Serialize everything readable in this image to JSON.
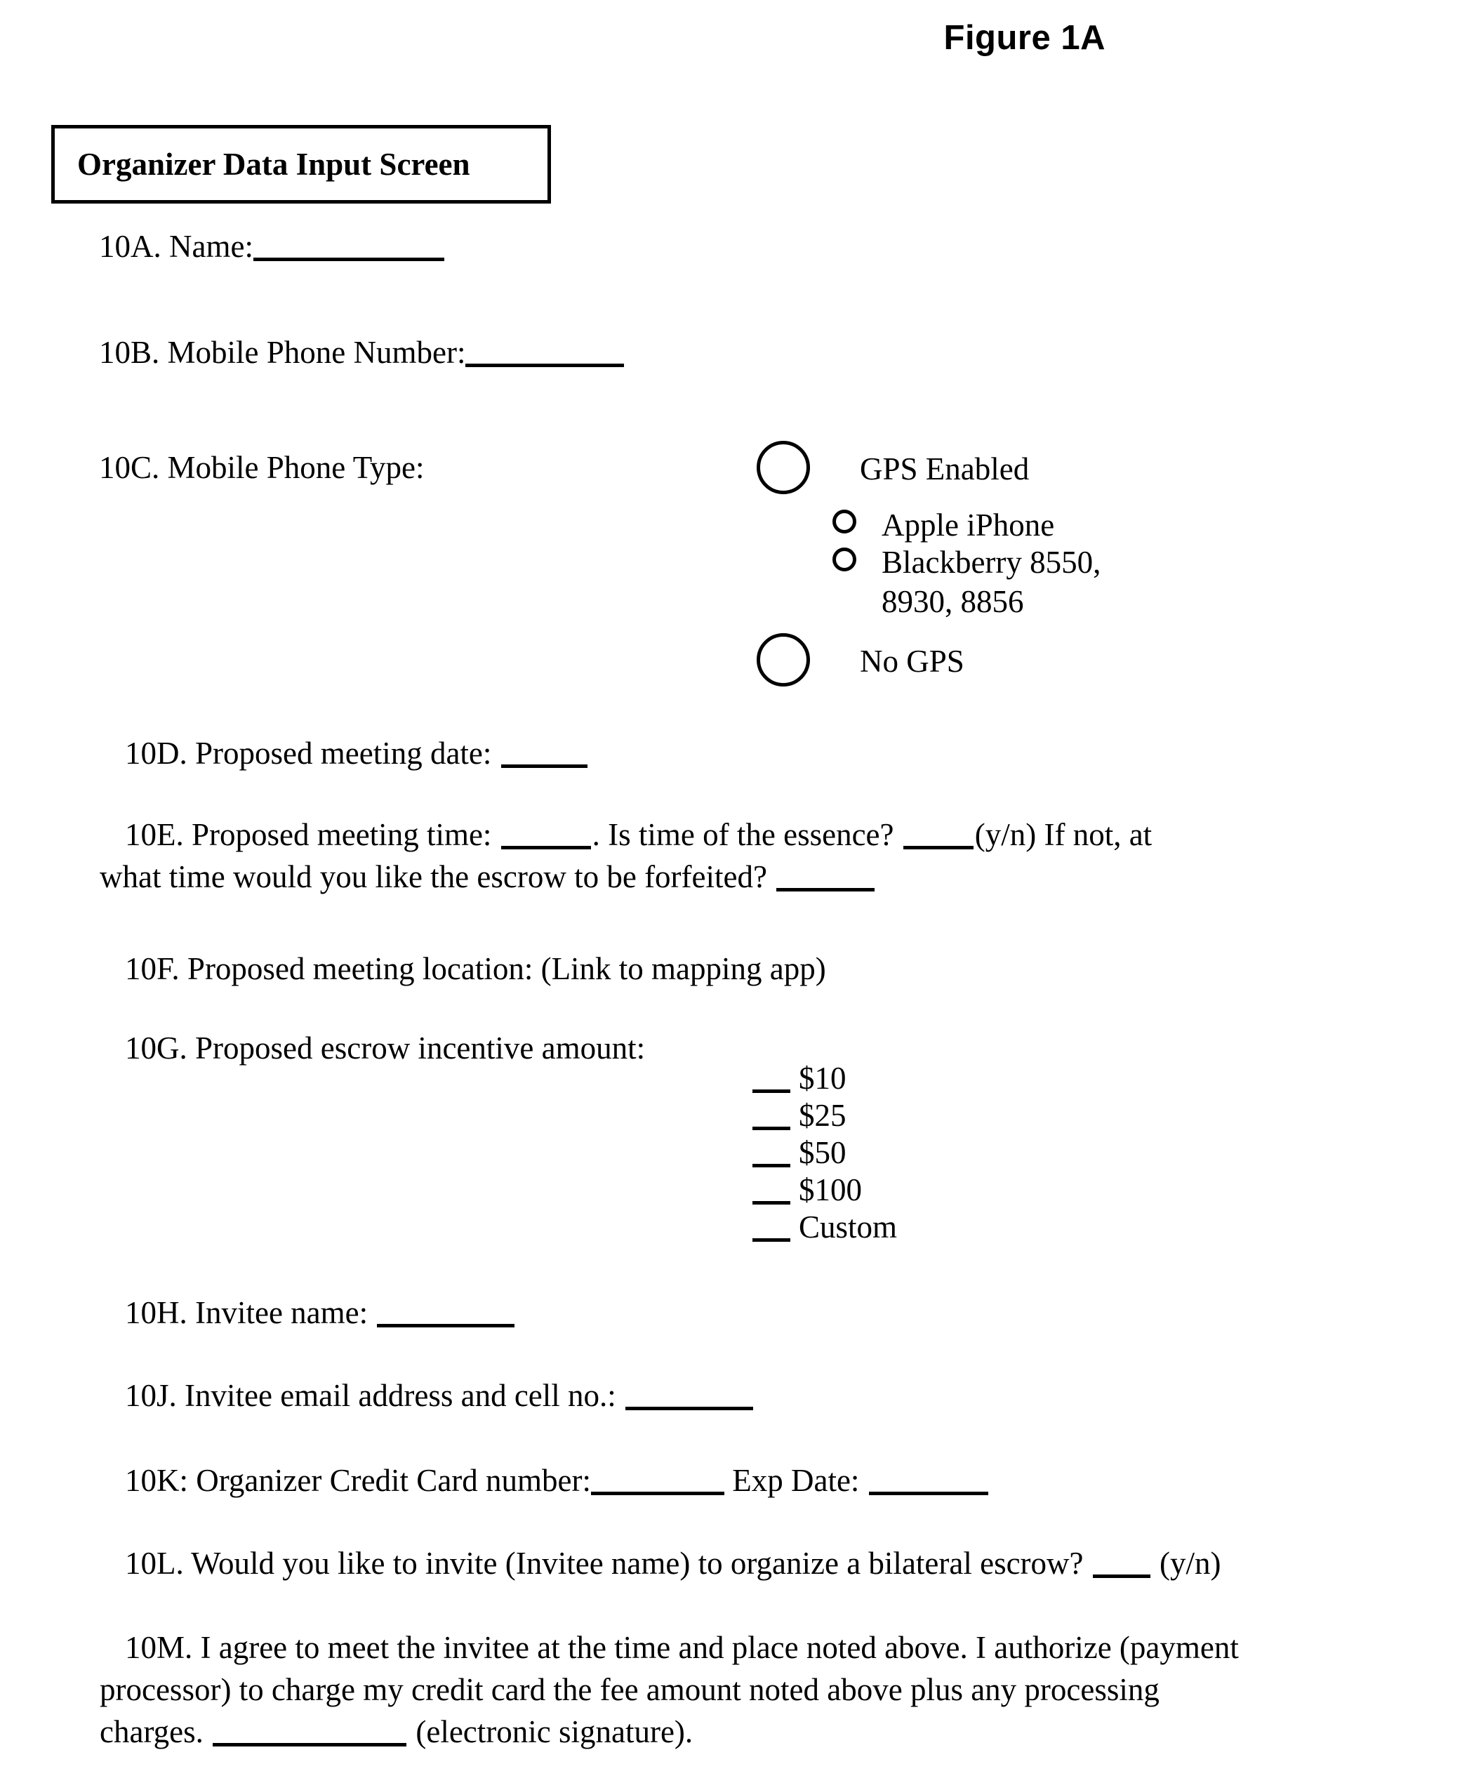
{
  "figure": {
    "caption": "Figure 1A"
  },
  "title_box": {
    "label": "Organizer Data Input Screen"
  },
  "fields": {
    "name": {
      "id": "10A.",
      "label": "10A. Name:"
    },
    "mobile_phone_number": {
      "id": "10B.",
      "label": "10B. Mobile Phone Number:"
    },
    "mobile_phone_type": {
      "id": "10C.",
      "label": "10C. Mobile Phone Type:",
      "options": [
        {
          "value": "gps-enabled",
          "label": "GPS Enabled",
          "size": "large"
        },
        {
          "value": "apple-iphone",
          "label": "Apple iPhone",
          "size": "small"
        },
        {
          "value": "blackberry",
          "label": "Blackberry 8550,\n8930, 8856",
          "size": "small"
        },
        {
          "value": "no-gps",
          "label": "No GPS",
          "size": "large"
        }
      ]
    },
    "meeting_date": {
      "id": "10D.",
      "label": "10D. Proposed meeting date:"
    },
    "meeting_time": {
      "id": "10E.",
      "line1_part1": "10E. Proposed meeting time:",
      "line1_part2": ". Is time of the essence?",
      "line1_part3": "(y/n) If not, at",
      "line2_part1": "what time would you like the escrow to be forfeited?"
    },
    "meeting_location": {
      "id": "10F.",
      "label": "10F. Proposed meeting location: (Link to mapping app)"
    },
    "escrow_incentive": {
      "id": "10G.",
      "label": "10G. Proposed escrow incentive amount:",
      "amounts": [
        "$10",
        "$25",
        "$50",
        "$100",
        "Custom"
      ]
    },
    "invitee_name": {
      "id": "10H.",
      "label": "10H. Invitee name:"
    },
    "invitee_contact": {
      "id": "10J.",
      "label": "10J. Invitee email address and cell no.:"
    },
    "credit_card": {
      "id": "10K:",
      "label_part1": "10K: Organizer Credit Card number:",
      "label_part2": "Exp Date:"
    },
    "bilateral_invite": {
      "id": "10L.",
      "label_part1": "10L. Would you like to invite (Invitee name) to organize a bilateral escrow?",
      "label_part2": "(y/n)"
    },
    "agreement": {
      "id": "10M.",
      "line1": "10M. I agree to meet the invitee at the time and place noted above. I authorize (payment",
      "line2": "processor) to charge my credit card the fee amount noted above plus any processing",
      "line3_part1": "charges.",
      "line3_part2": "(electronic signature)."
    }
  },
  "colors": {
    "ink": "#000000",
    "paper": "#ffffff"
  }
}
